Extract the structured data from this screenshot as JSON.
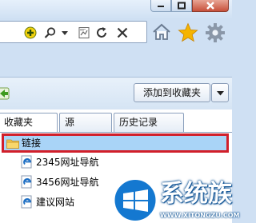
{
  "browser": {
    "window_buttons": [
      "minimize",
      "maximize",
      "close"
    ],
    "toolbar_icons": [
      "compatibility-icon",
      "search-icon",
      "dropdown-icon",
      "compat-view-icon",
      "refresh-icon",
      "stop-icon",
      "home-icon",
      "favorites-star-icon",
      "tools-gear-icon"
    ]
  },
  "favorites_panel": {
    "add_button_label": "添加到收藏夹",
    "tabs": [
      {
        "label": "收藏夹",
        "active": true
      },
      {
        "label": "源",
        "active": false
      },
      {
        "label": "历史记录",
        "active": false
      }
    ],
    "folder": {
      "label": "链接",
      "selected": true
    },
    "links": [
      {
        "label": "2345网址导航"
      },
      {
        "label": "3456网址导航"
      },
      {
        "label": "建议网站"
      }
    ]
  },
  "watermark": {
    "brand": "系统族",
    "url": "WWW.XITONGZU.COM"
  },
  "colors": {
    "selection_bg": "#a9d4f7",
    "selection_border": "#d11f2a",
    "star": "#f5b400",
    "ie_blue": "#1e6fc4"
  }
}
